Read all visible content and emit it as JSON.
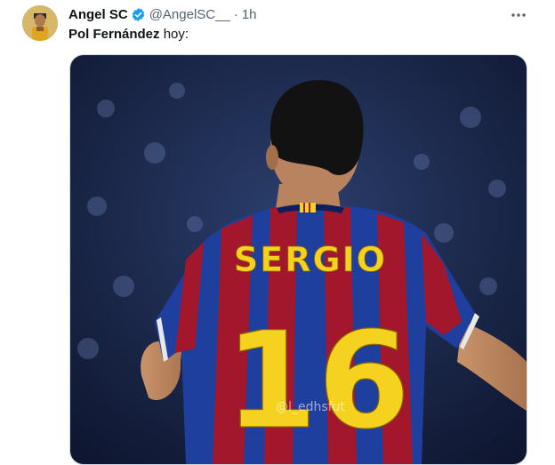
{
  "tweet": {
    "author_name": "Angel SC",
    "handle": "@AngelSC__",
    "separator": "·",
    "time": "1h",
    "text_bold": "Pol Fernández",
    "text_rest": " hoy:",
    "verified": true
  },
  "media": {
    "jersey_name": "SERGIO",
    "jersey_number": "16",
    "watermark": "@l_edhsfut"
  },
  "icons": {
    "verified": "verified-badge-icon",
    "more": "more-options-icon"
  },
  "colors": {
    "verified_blue": "#1d9bf0",
    "secondary_text": "#536471",
    "jersey_blue": "#1f3f9e",
    "jersey_red": "#a3172c",
    "jersey_yellow": "#f5d21f"
  }
}
